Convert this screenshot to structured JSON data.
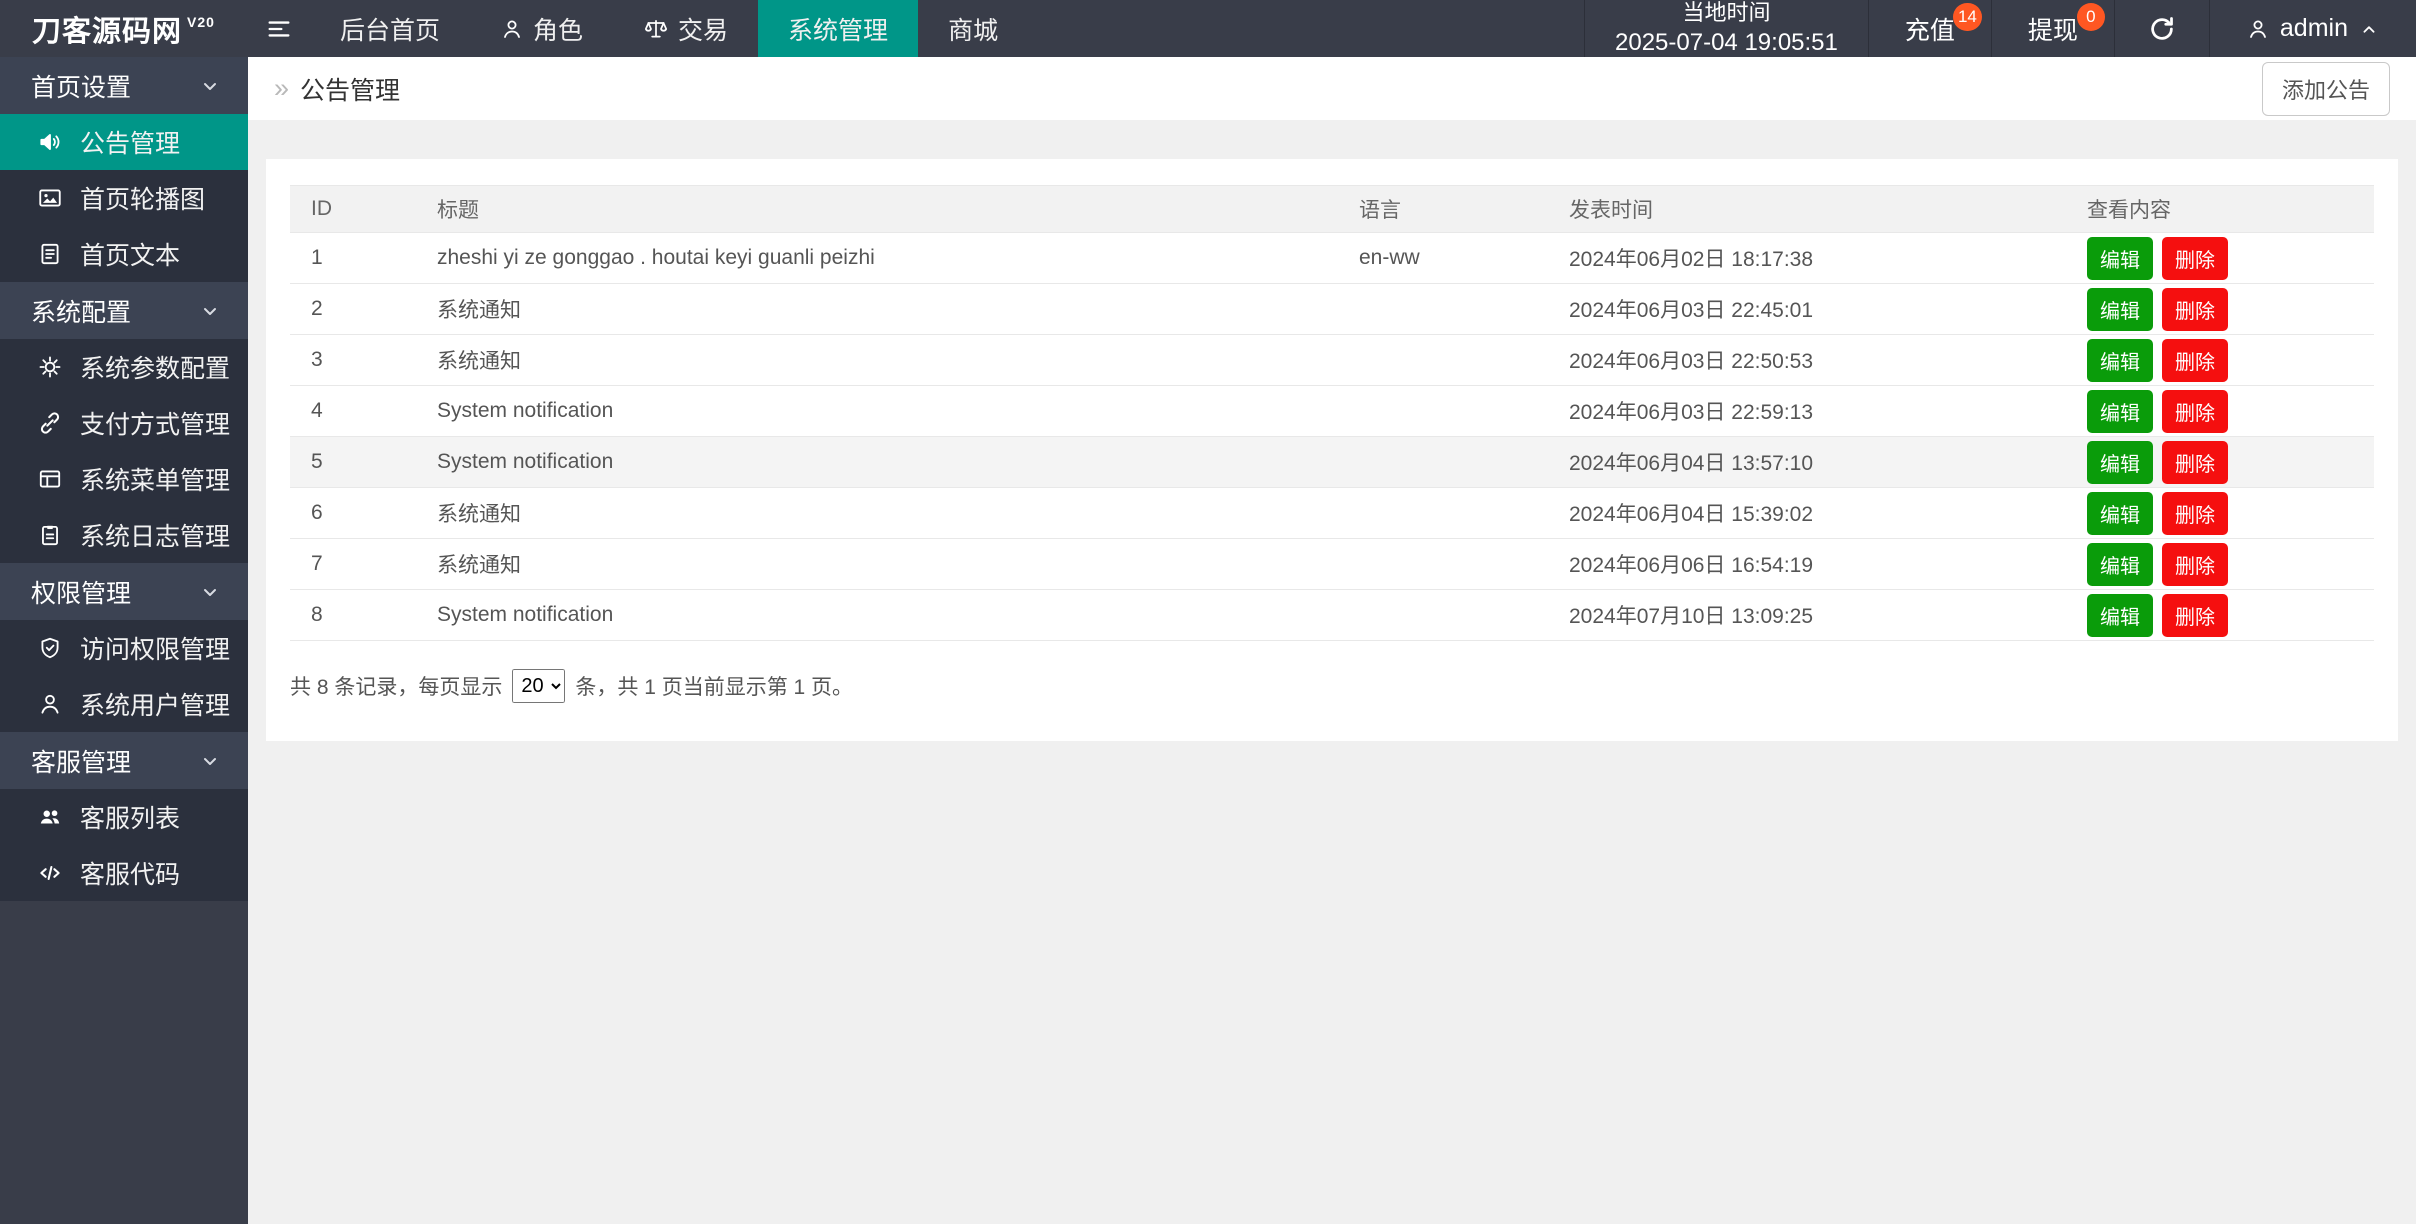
{
  "navbar": {
    "logo": "刀客源码网",
    "logo_version": "V20",
    "menu_items": [
      {
        "label": "后台首页"
      },
      {
        "label": "角色"
      },
      {
        "label": "交易"
      },
      {
        "label": "系统管理",
        "active": true
      },
      {
        "label": "商城"
      }
    ],
    "local_time_label": "当地时间",
    "local_time_value": "2025-07-04 19:05:51",
    "recharge_label": "充值",
    "recharge_badge": "14",
    "withdraw_label": "提现",
    "withdraw_badge": "0",
    "username": "admin"
  },
  "sidebar": {
    "groups": [
      {
        "header": "首页设置",
        "items": [
          {
            "label": "公告管理",
            "icon": "announcement",
            "active": true
          },
          {
            "label": "首页轮播图",
            "icon": "carousel-image"
          },
          {
            "label": "首页文本",
            "icon": "document"
          }
        ]
      },
      {
        "header": "系统配置",
        "items": [
          {
            "label": "系统参数配置",
            "icon": "gear"
          },
          {
            "label": "支付方式管理",
            "icon": "link"
          },
          {
            "label": "系统菜单管理",
            "icon": "menu-window"
          },
          {
            "label": "系统日志管理",
            "icon": "log-clipboard"
          }
        ]
      },
      {
        "header": "权限管理",
        "items": [
          {
            "label": "访问权限管理",
            "icon": "shield-check"
          },
          {
            "label": "系统用户管理",
            "icon": "user"
          }
        ]
      },
      {
        "header": "客服管理",
        "items": [
          {
            "label": "客服列表",
            "icon": "users"
          },
          {
            "label": "客服代码",
            "icon": "code"
          }
        ]
      }
    ]
  },
  "main": {
    "breadcrumb": "公告管理",
    "add_button_label": "添加公告",
    "table": {
      "columns": [
        "ID",
        "标题",
        "语言",
        "发表时间",
        "查看内容"
      ],
      "edit_label": "编辑",
      "delete_label": "删除",
      "rows": [
        {
          "id": "1",
          "title": "zheshi yi ze gonggao . houtai keyi guanli peizhi",
          "language": "en-ww",
          "published_at": "2024年06月02日 18:17:38",
          "highlighted": false
        },
        {
          "id": "2",
          "title": "系统通知",
          "language": "",
          "published_at": "2024年06月03日 22:45:01",
          "highlighted": false
        },
        {
          "id": "3",
          "title": "系统通知",
          "language": "",
          "published_at": "2024年06月03日 22:50:53",
          "highlighted": false
        },
        {
          "id": "4",
          "title": "System notification",
          "language": "",
          "published_at": "2024年06月03日 22:59:13",
          "highlighted": false
        },
        {
          "id": "5",
          "title": "System notification",
          "language": "",
          "published_at": "2024年06月04日 13:57:10",
          "highlighted": true
        },
        {
          "id": "6",
          "title": "系统通知",
          "language": "",
          "published_at": "2024年06月04日 15:39:02",
          "highlighted": false
        },
        {
          "id": "7",
          "title": "系统通知",
          "language": "",
          "published_at": "2024年06月06日 16:54:19",
          "highlighted": false
        },
        {
          "id": "8",
          "title": "System notification",
          "language": "",
          "published_at": "2024年07月10日 13:09:25",
          "highlighted": false
        }
      ]
    },
    "pagination": {
      "prefix": "共 8 条记录，每页显示",
      "page_size": "20",
      "suffix": "条，共 1 页当前显示第 1 页。"
    }
  },
  "colors": {
    "accent_teal": "#009688",
    "badge_orange": "#ff5722",
    "edit_green": "#0a9c0a",
    "delete_red": "#f50f0f",
    "navbar_bg": "#393d49",
    "submenu_bg": "#2b303d"
  }
}
